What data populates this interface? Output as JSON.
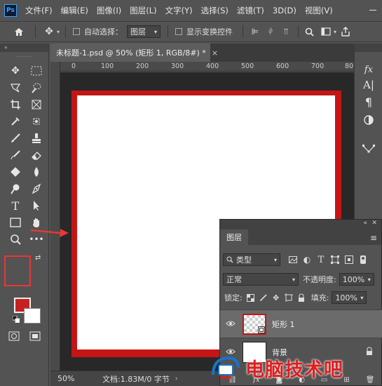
{
  "app": {
    "logo": "Ps"
  },
  "menu": [
    "文件(F)",
    "编辑(E)",
    "图像(I)",
    "图层(L)",
    "文字(Y)",
    "选择(S)",
    "滤镜(T)",
    "3D(D)",
    "视图(V)"
  ],
  "options_bar": {
    "auto_select_label": "自动选择：",
    "auto_select_target": "图层",
    "show_transform_label": "显示变换控件"
  },
  "document": {
    "tab_title": "未标题-1.psd @ 50% (矩形 1, RGB/8#) *",
    "tab_close": "×",
    "ruler_ticks": [
      "0",
      "100",
      "200",
      "300",
      "400",
      "500",
      "600",
      "700",
      "80"
    ],
    "canvas_border_color": "#c51515",
    "canvas_fill_color": "#ffffff"
  },
  "status": {
    "zoom": "50%",
    "doc_info": "文档:1.83M/0 字节"
  },
  "colors": {
    "foreground": "#c62121",
    "background": "#ffffff",
    "highlight": "#e53935"
  },
  "layers_panel": {
    "tab": "图层",
    "filter_type": "类型",
    "blend_mode": "正常",
    "opacity_label": "不透明度:",
    "opacity_value": "100%",
    "lock_label": "锁定:",
    "fill_label": "填充:",
    "fill_value": "100%",
    "layers": [
      {
        "name": "矩形 1",
        "selected": true
      },
      {
        "name": "背景",
        "selected": false
      }
    ]
  },
  "watermark": {
    "text": "电脑技术吧"
  }
}
